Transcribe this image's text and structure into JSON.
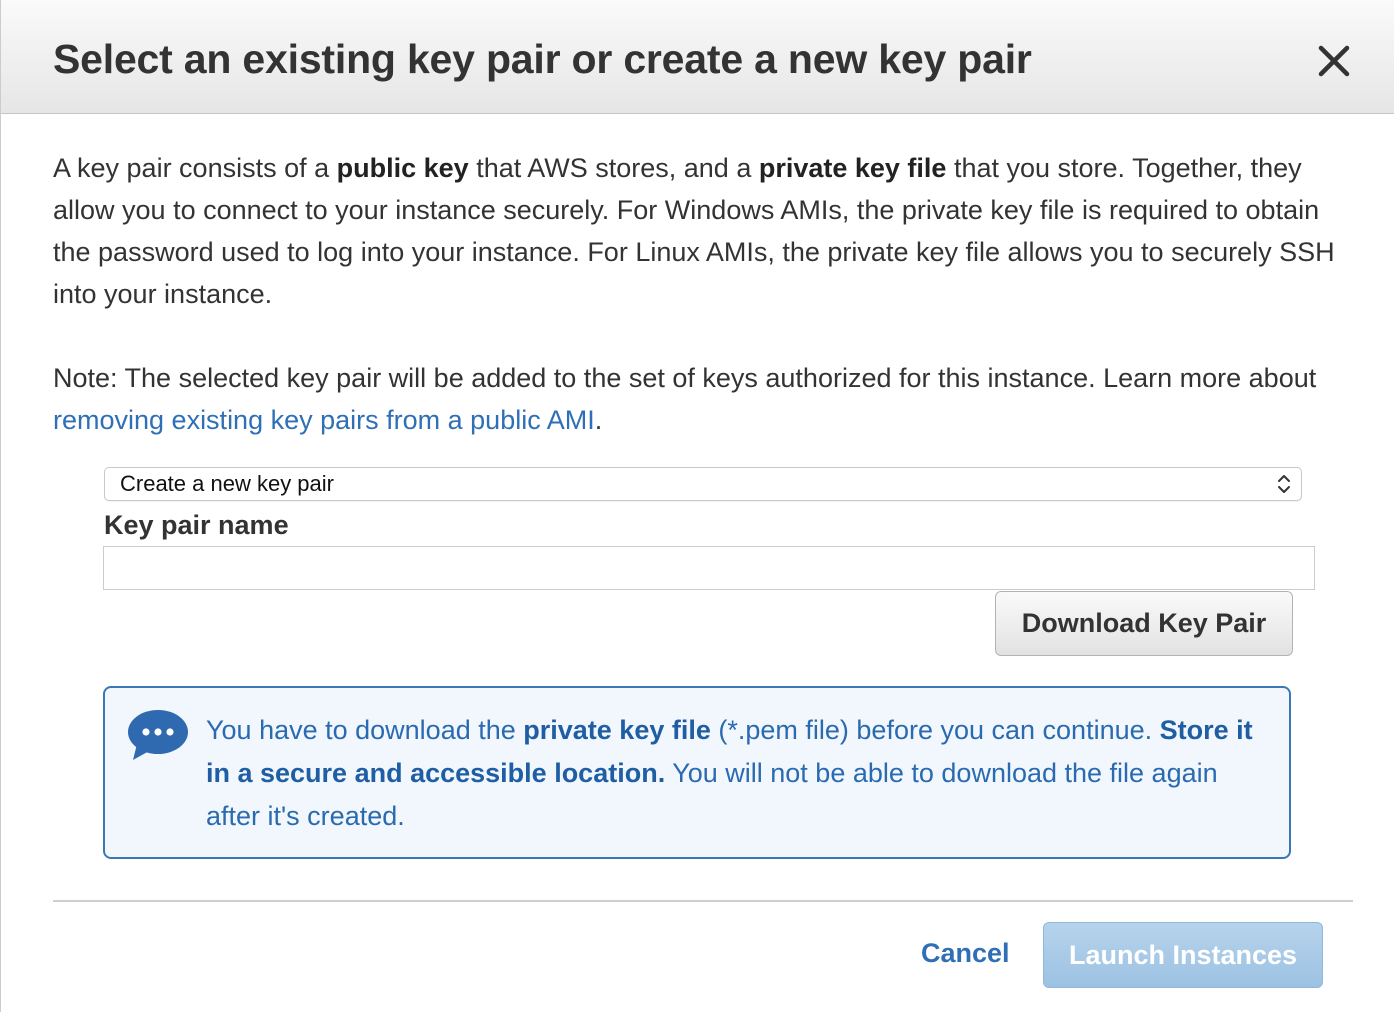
{
  "dialog": {
    "title": "Select an existing key pair or create a new key pair",
    "close_icon": "close-icon"
  },
  "intro": {
    "t1": "A key pair consists of a ",
    "b1": "public key",
    "t2": " that AWS stores, and a ",
    "b2": "private key file",
    "t3": " that you store. Together, they allow you to connect to your instance securely. For Windows AMIs, the private key file is required to obtain the password used to log into your instance. For Linux AMIs, the private key file allows you to securely SSH into your instance."
  },
  "note": {
    "text": "Note: The selected key pair will be added to the set of keys authorized for this instance. Learn more about ",
    "link": "removing existing key pairs from a public AMI",
    "end": "."
  },
  "key_select": {
    "selected": "Create a new key pair",
    "icon": "chevron-up-down-icon"
  },
  "key_name": {
    "label": "Key pair name",
    "value": "",
    "placeholder": ""
  },
  "download_button": "Download Key Pair",
  "info": {
    "icon": "chat-bubble-icon",
    "t1": "You have to download the ",
    "b1": "private key file",
    "t2": " (*.pem file) before you can continue. ",
    "b2": "Store it in a secure and accessible location.",
    "t3": " You will not be able to download the file again after it's created."
  },
  "footer": {
    "cancel": "Cancel",
    "launch": "Launch Instances"
  },
  "colors": {
    "link": "#2e6fb5",
    "info_border": "#3a77b5",
    "info_bg": "#f1f7fd",
    "launch_disabled": "#a8cbe8"
  }
}
